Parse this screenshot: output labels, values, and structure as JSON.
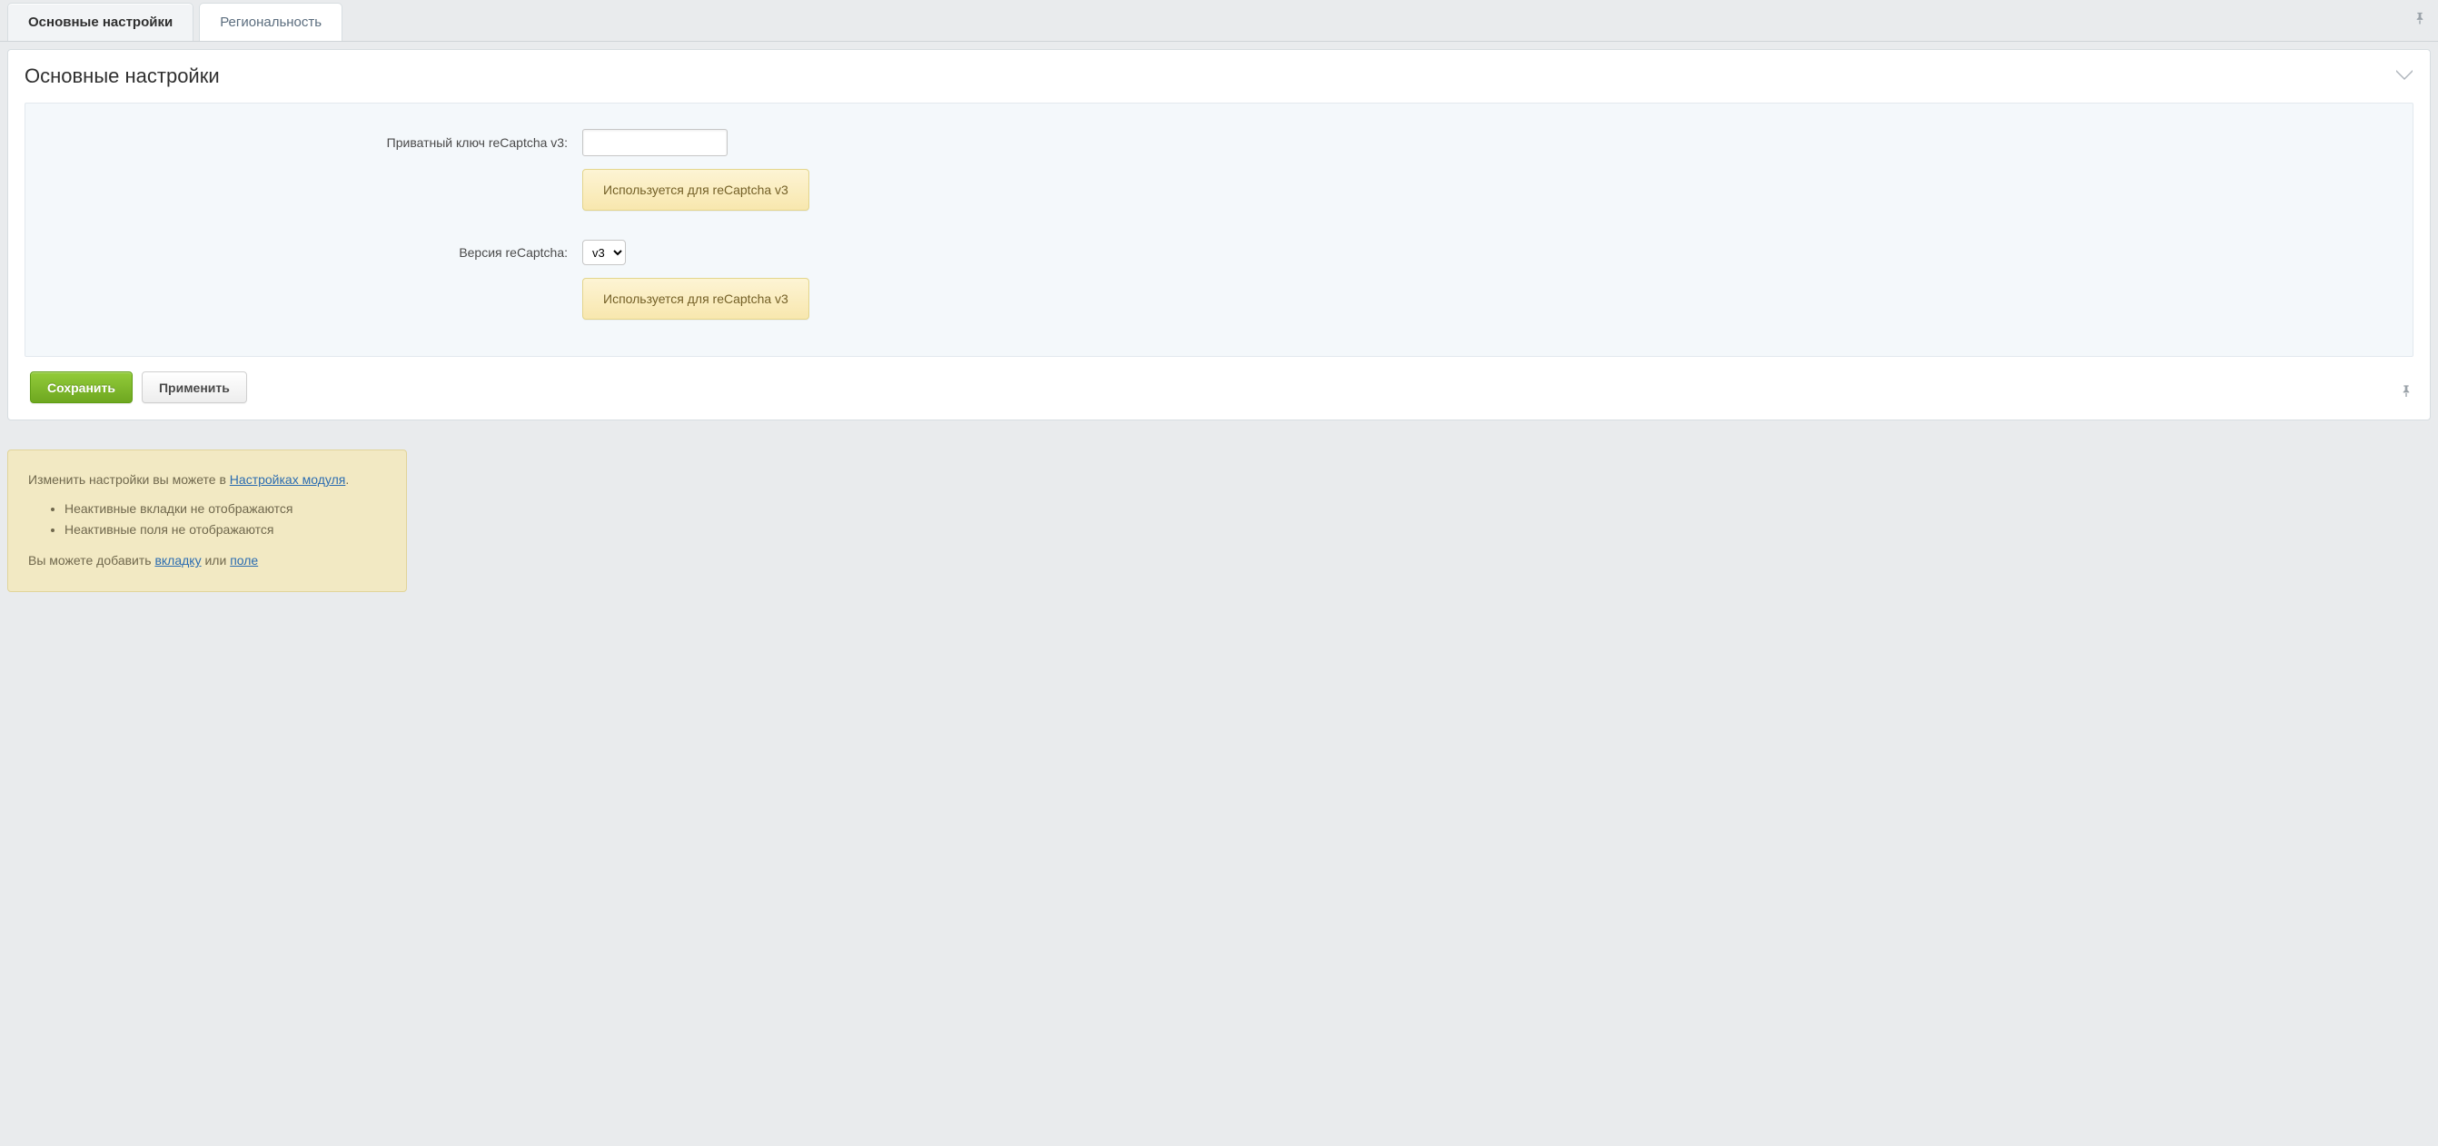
{
  "tabs": {
    "main": "Основные настройки",
    "regional": "Региональность"
  },
  "panel": {
    "title": "Основные настройки"
  },
  "form": {
    "private_key_label": "Приватный ключ reCaptcha v3:",
    "private_key_value": "",
    "info_button_1": "Используется для reCaptcha v3",
    "version_label": "Версия reCaptcha:",
    "version_value": "v3",
    "info_button_2": "Используется для reCaptcha v3"
  },
  "buttons": {
    "save": "Сохранить",
    "apply": "Применить"
  },
  "note": {
    "line1_prefix": "Изменить настройки вы можете в ",
    "line1_link": "Настройках модуля",
    "line1_suffix": ".",
    "bullet1": "Неактивные вкладки не отображаются",
    "bullet2": "Неактивные поля не отображаются",
    "line2_prefix": "Вы можете добавить ",
    "line2_link1": "вкладку",
    "line2_mid": " или ",
    "line2_link2": "поле"
  }
}
